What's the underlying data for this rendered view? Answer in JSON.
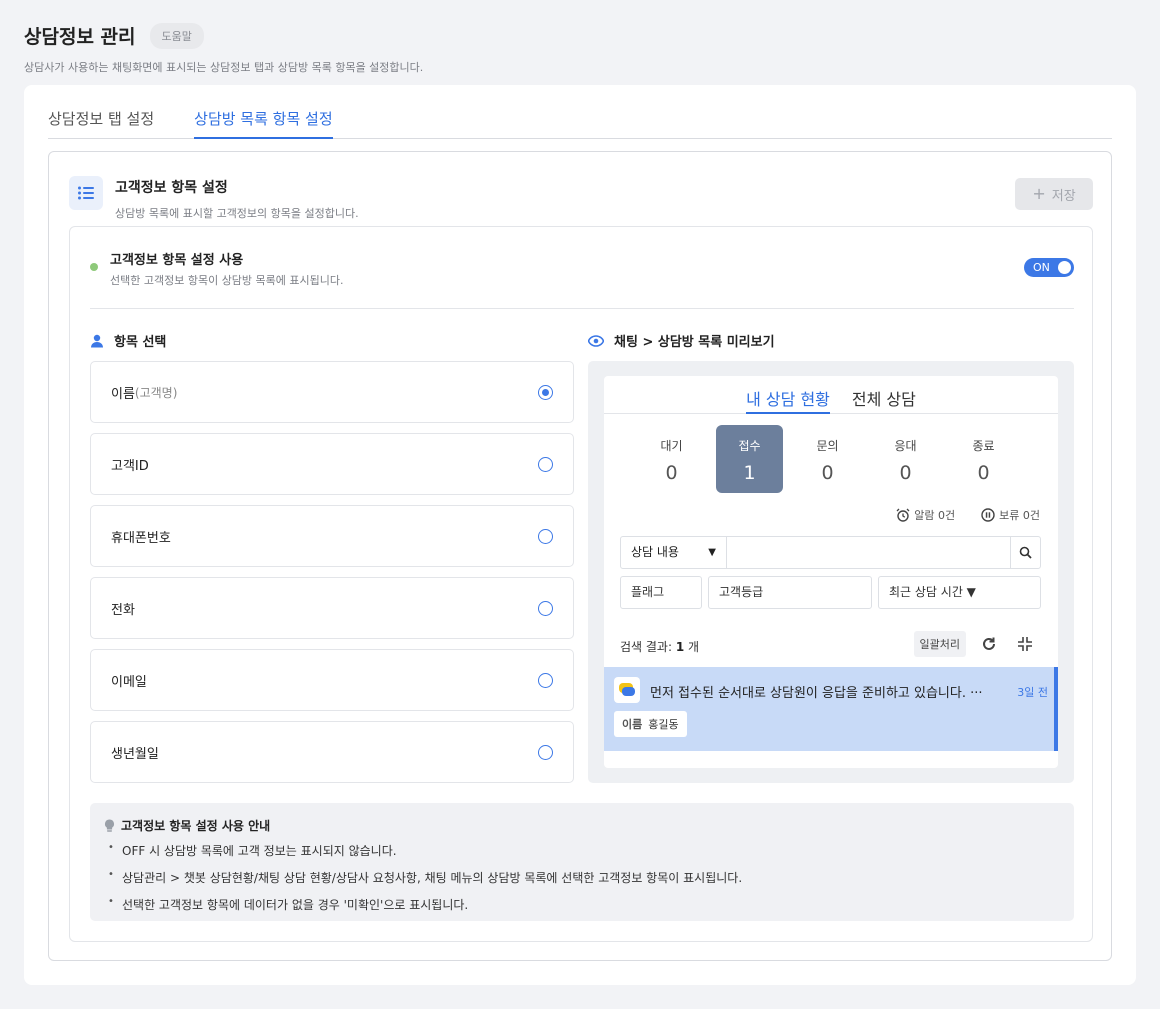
{
  "page": {
    "title": "상담정보 관리",
    "help_label": "도움말",
    "description": "상담사가 사용하는 채팅화면에 표시되는 상담정보 탭과 상담방 목록 항목을 설정합니다."
  },
  "tabs": [
    {
      "label": "상담정보 탭 설정",
      "active": false
    },
    {
      "label": "상담방 목록 항목 설정",
      "active": true
    }
  ],
  "section": {
    "title": "고객정보 항목 설정",
    "description": "상담방 목록에 표시할 고객정보의 항목을 설정합니다.",
    "save_label": "저장",
    "save_icon": "plus-icon"
  },
  "usage": {
    "title": "고객정보 항목 설정 사용",
    "description": "선택한 고객정보 항목이 상담방 목록에 표시됩니다.",
    "toggle_label": "ON",
    "toggle_on": true
  },
  "item_select": {
    "title": "항목 선택",
    "icon": "user-icon",
    "items": [
      {
        "label": "이름",
        "sub": "(고객명)",
        "selected": true
      },
      {
        "label": "고객ID",
        "sub": "",
        "selected": false
      },
      {
        "label": "휴대폰번호",
        "sub": "",
        "selected": false
      },
      {
        "label": "전화",
        "sub": "",
        "selected": false
      },
      {
        "label": "이메일",
        "sub": "",
        "selected": false
      },
      {
        "label": "생년월일",
        "sub": "",
        "selected": false
      }
    ]
  },
  "preview": {
    "title": "채팅 > 상담방 목록 미리보기",
    "icon": "eye-icon",
    "tabs": [
      {
        "label": "내 상담 현황",
        "active": true
      },
      {
        "label": "전체 상담",
        "active": false
      }
    ],
    "stats": [
      {
        "label": "대기",
        "value": "0",
        "active": false
      },
      {
        "label": "접수",
        "value": "1",
        "active": true
      },
      {
        "label": "문의",
        "value": "0",
        "active": false
      },
      {
        "label": "응대",
        "value": "0",
        "active": false
      },
      {
        "label": "종료",
        "value": "0",
        "active": false
      }
    ],
    "alarm_label": "알람 0건",
    "hold_label": "보류 0건",
    "search_select": "상담 내용",
    "search_value": "",
    "filters": [
      "플래그",
      "고객등급",
      "최근 상담 시간 ▼"
    ],
    "results_prefix": "검색 결과: ",
    "results_count": "1",
    "results_suffix": " 개",
    "bulk_label": "일괄처리",
    "chat": {
      "message": "먼저 접수된 순서대로 상담원이 응답을 준비하고 있습니다. ···",
      "time": "3일 전",
      "tag_label": "이름",
      "tag_value": "홍길동"
    }
  },
  "notice": {
    "title": "고객정보 항목 설정 사용 안내",
    "items": [
      "OFF 시 상담방 목록에 고객 정보는 표시되지 않습니다.",
      "상담관리 > 챗봇 상담현황/채팅 상담 현황/상담사 요청사항, 채팅 메뉴의 상담방 목록에 선택한 고객정보 항목이 표시됩니다.",
      "선택한 고객정보 항목에 데이터가 없을 경우 '미확인'으로 표시됩니다."
    ]
  }
}
